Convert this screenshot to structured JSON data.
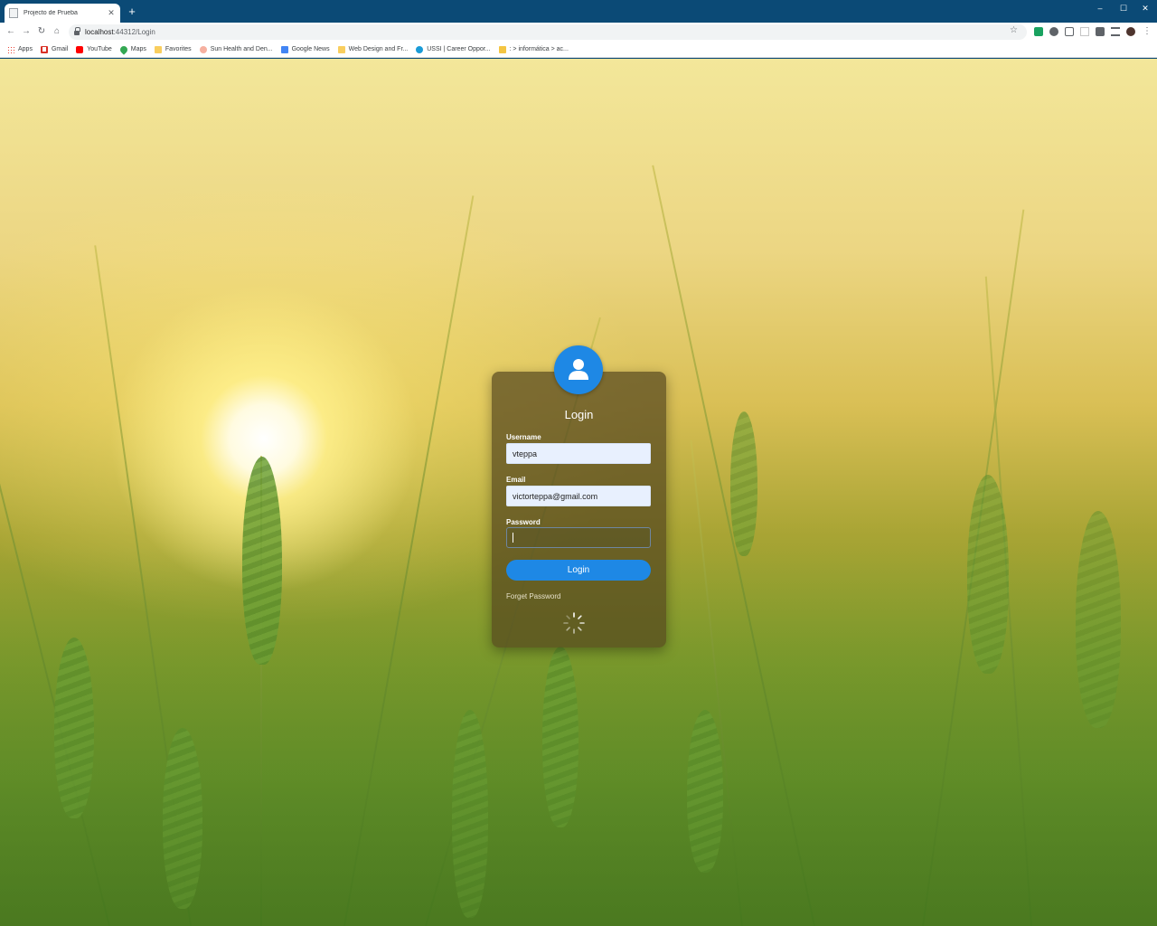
{
  "browser": {
    "tab_title": "Projecto de Prueba",
    "tab_close": "✕",
    "new_tab": "+",
    "url_host": "localhost",
    "url_rest": ":44312/Login",
    "window_controls": [
      "–",
      "☐",
      "✕"
    ]
  },
  "bookmarks": [
    {
      "label": "Apps",
      "color": "#ea4335"
    },
    {
      "label": "Gmail",
      "color": "#d93025"
    },
    {
      "label": "YouTube",
      "color": "#ff0000"
    },
    {
      "label": "Maps",
      "color": "#34a853"
    },
    {
      "label": "Favorites",
      "color": "#f9ce5e"
    },
    {
      "label": "Sun Health and Den...",
      "color": "#f6b0a0"
    },
    {
      "label": "Google News",
      "color": "#4285f4"
    },
    {
      "label": "Web Design and Fr...",
      "color": "#f9ce5e"
    },
    {
      "label": "USSI | Career Oppor...",
      "color": "#1a9bd7"
    },
    {
      "label": ": > informática > ac...",
      "color": "#f4c542"
    }
  ],
  "login": {
    "title": "Login",
    "username_label": "Username",
    "username_value": "vteppa",
    "email_label": "Email",
    "email_value": "victorteppa@gmail.com",
    "password_label": "Password",
    "button_label": "Login",
    "forgot_label": "Forget Password",
    "accent_color": "#1e88e5"
  }
}
